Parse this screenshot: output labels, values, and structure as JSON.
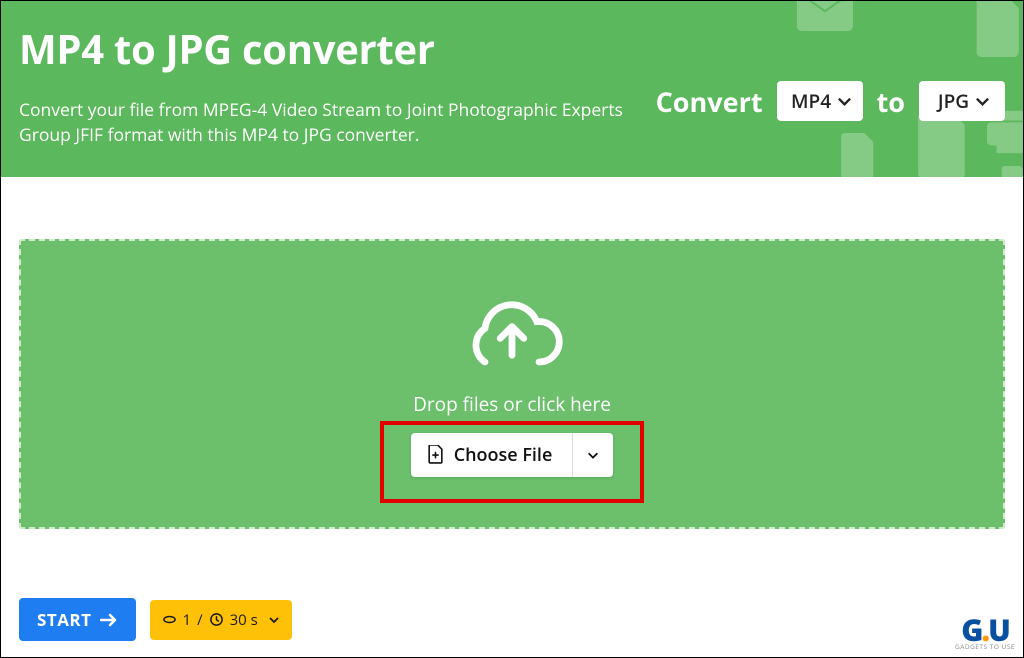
{
  "header": {
    "title": "MP4 to JPG converter",
    "description": "Convert your file from MPEG-4 Video Stream to Joint Photographic Experts Group JFIF format with this MP4 to JPG converter."
  },
  "conversion": {
    "label_convert": "Convert",
    "format_from": "MP4",
    "label_to": "to",
    "format_to": "JPG"
  },
  "dropzone": {
    "hint": "Drop files or click here",
    "choose_label": "Choose File"
  },
  "actions": {
    "start_label": "START",
    "options_count": "1",
    "options_sep": "/",
    "options_duration": "30 s"
  },
  "branding": {
    "logo_letters": "GU",
    "tagline": "GADGETS TO USE"
  }
}
